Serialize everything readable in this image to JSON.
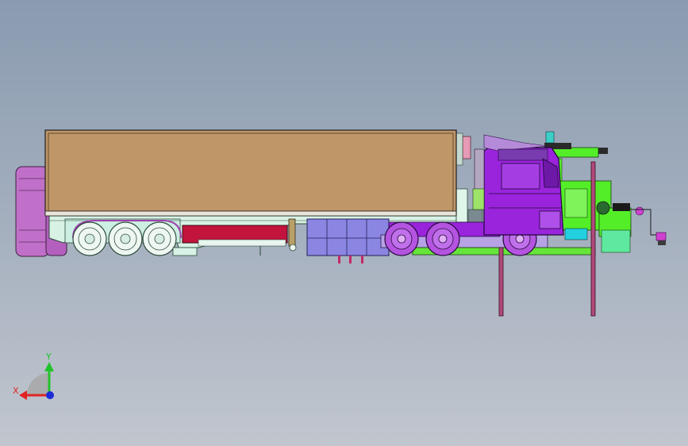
{
  "viewport": {
    "background_top": "#8a9bb0",
    "background_bottom": "#c1c6ce"
  },
  "model": {
    "description_icon": "truck-trailer-model",
    "colors": {
      "trailer_box": "#bf9668",
      "trailer_frame": "#d8f2e6",
      "cab": "#9a24dc",
      "green_structure": "#54ee28",
      "red_panel": "#c2143d",
      "blue_box": "#8a86e2",
      "spare_wheel": "#c070c8"
    }
  },
  "triad": {
    "x_label": "X",
    "y_label": "Y",
    "x_color": "#e02424",
    "y_color": "#22c22a",
    "z_color": "#1e2ad8"
  }
}
